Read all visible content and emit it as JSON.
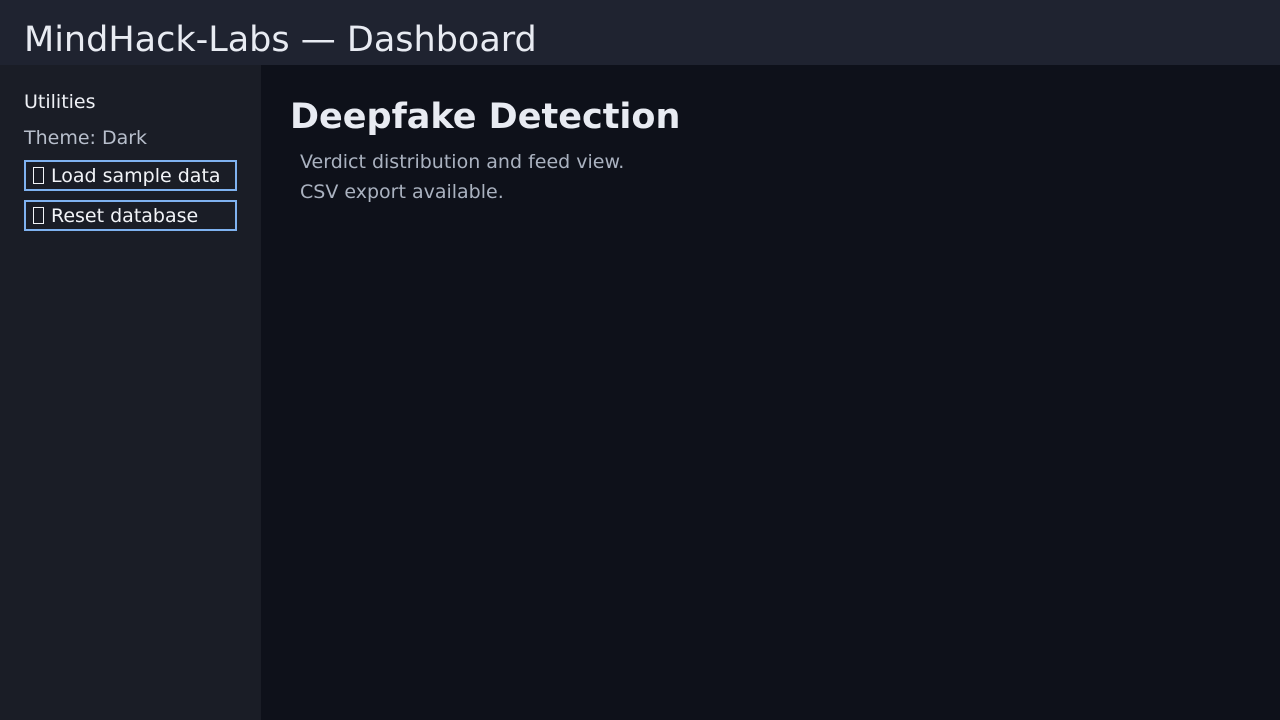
{
  "header": {
    "title": "MindHack-Labs — Dashboard"
  },
  "sidebar": {
    "heading": "Utilities",
    "theme_label": "Theme: Dark",
    "buttons": [
      {
        "label": "Load sample data",
        "icon": "missing-glyph-icon"
      },
      {
        "label": "Reset database",
        "icon": "missing-glyph-icon"
      }
    ]
  },
  "main": {
    "title": "Deepfake Detection",
    "description": [
      "Verdict distribution and feed view.",
      "CSV export available."
    ]
  },
  "colors": {
    "background": "#0e111a",
    "topbar": "#1f2330",
    "sidebar": "#1a1d26",
    "button_border": "#7fb2f0"
  }
}
